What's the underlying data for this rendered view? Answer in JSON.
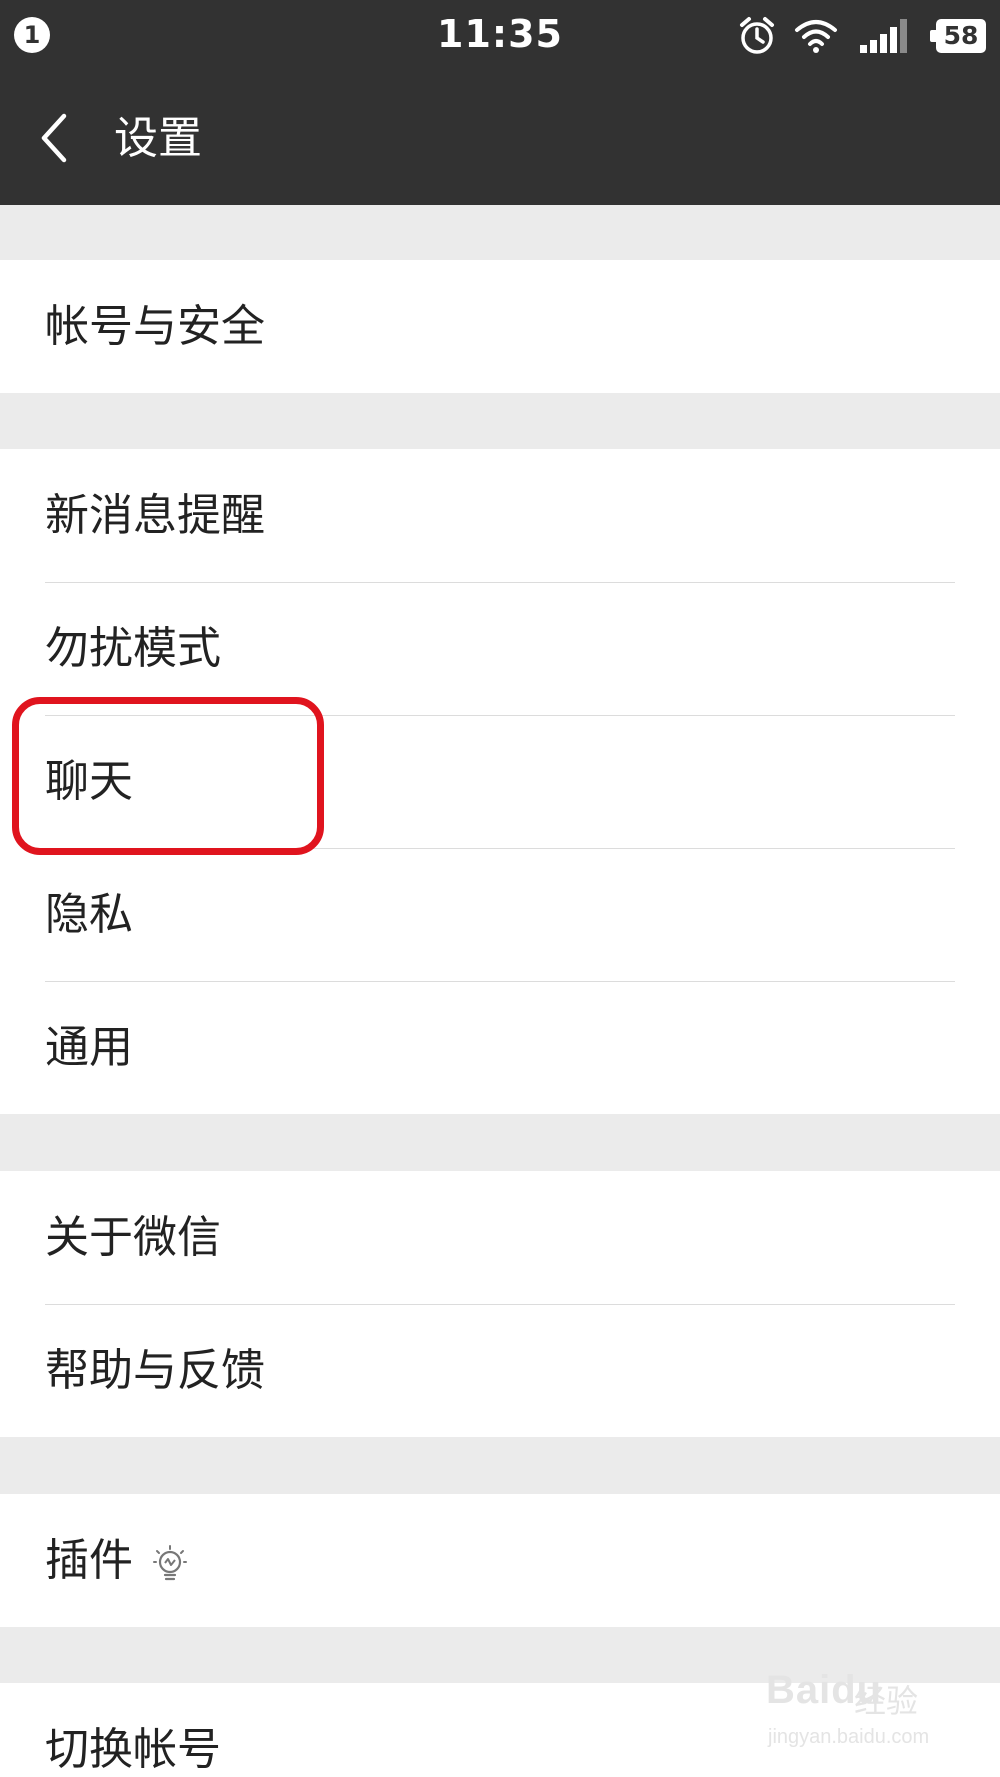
{
  "status_bar": {
    "notification_count": "1",
    "time": "11:35",
    "battery": "58",
    "icons": [
      "alarm-icon",
      "wifi-icon",
      "signal-icon",
      "battery-icon"
    ]
  },
  "header": {
    "back_icon": "chevron-left-icon",
    "title": "设置"
  },
  "groups": [
    {
      "items": [
        {
          "label": "帐号与安全"
        }
      ]
    },
    {
      "items": [
        {
          "label": "新消息提醒"
        },
        {
          "label": "勿扰模式"
        },
        {
          "label": "聊天"
        },
        {
          "label": "隐私"
        },
        {
          "label": "通用"
        }
      ]
    },
    {
      "items": [
        {
          "label": "关于微信"
        },
        {
          "label": "帮助与反馈"
        }
      ]
    },
    {
      "items": [
        {
          "label": "插件",
          "icon": "lightbulb-icon"
        }
      ]
    },
    {
      "items": [
        {
          "label": "切换帐号"
        }
      ]
    }
  ],
  "annotation": {
    "highlight_color": "#e0141e",
    "highlighted_item": "聊天"
  },
  "watermark": {
    "logo": "Baidu",
    "sub": "经验",
    "url": "jingyan.baidu.com"
  },
  "colors": {
    "bar": "#323232",
    "background": "#ebebeb",
    "row": "#ffffff",
    "text": "#222222"
  }
}
